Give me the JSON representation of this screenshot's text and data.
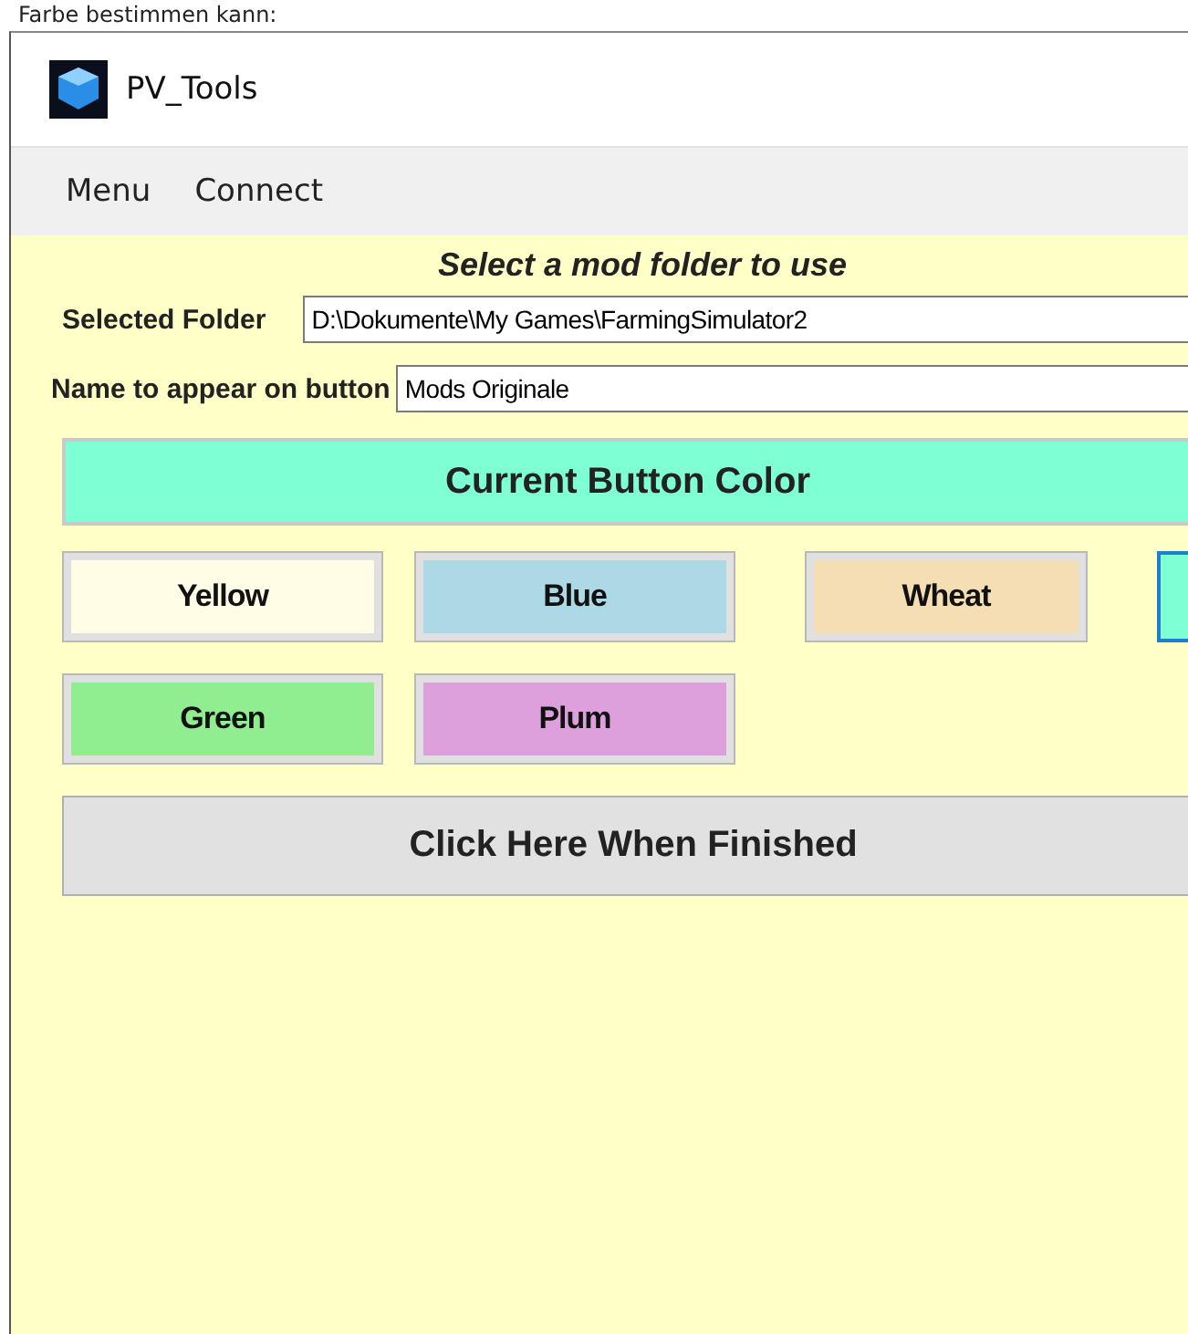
{
  "caption": "Farbe bestimmen kann:",
  "window": {
    "title": "PV_Tools"
  },
  "menu": [
    {
      "label": "Menu"
    },
    {
      "label": "Connect"
    }
  ],
  "heading": "Select a mod folder to use",
  "fields": [
    {
      "label": "Selected Folder",
      "value": "D:\\Dokumente\\My Games\\FarmingSimulator2"
    },
    {
      "label": "Name to appear on button",
      "value": "Mods Originale"
    }
  ],
  "current_color": {
    "label": "Current Button Color",
    "color": "#7fffd4"
  },
  "color_buttons": [
    {
      "label": "Yellow",
      "color": "#fffde6",
      "selected": false
    },
    {
      "label": "Blue",
      "color": "#add8e6",
      "selected": false
    },
    {
      "label": "Wheat",
      "color": "#f5deb3",
      "selected": false
    },
    {
      "color": "#7fffd4",
      "selected": true
    },
    {
      "label": "Green",
      "color": "#90ee90",
      "selected": false
    },
    {
      "label": "Plum",
      "color": "#dda0dd",
      "selected": false
    }
  ],
  "finish_button": "Click Here When Finished"
}
